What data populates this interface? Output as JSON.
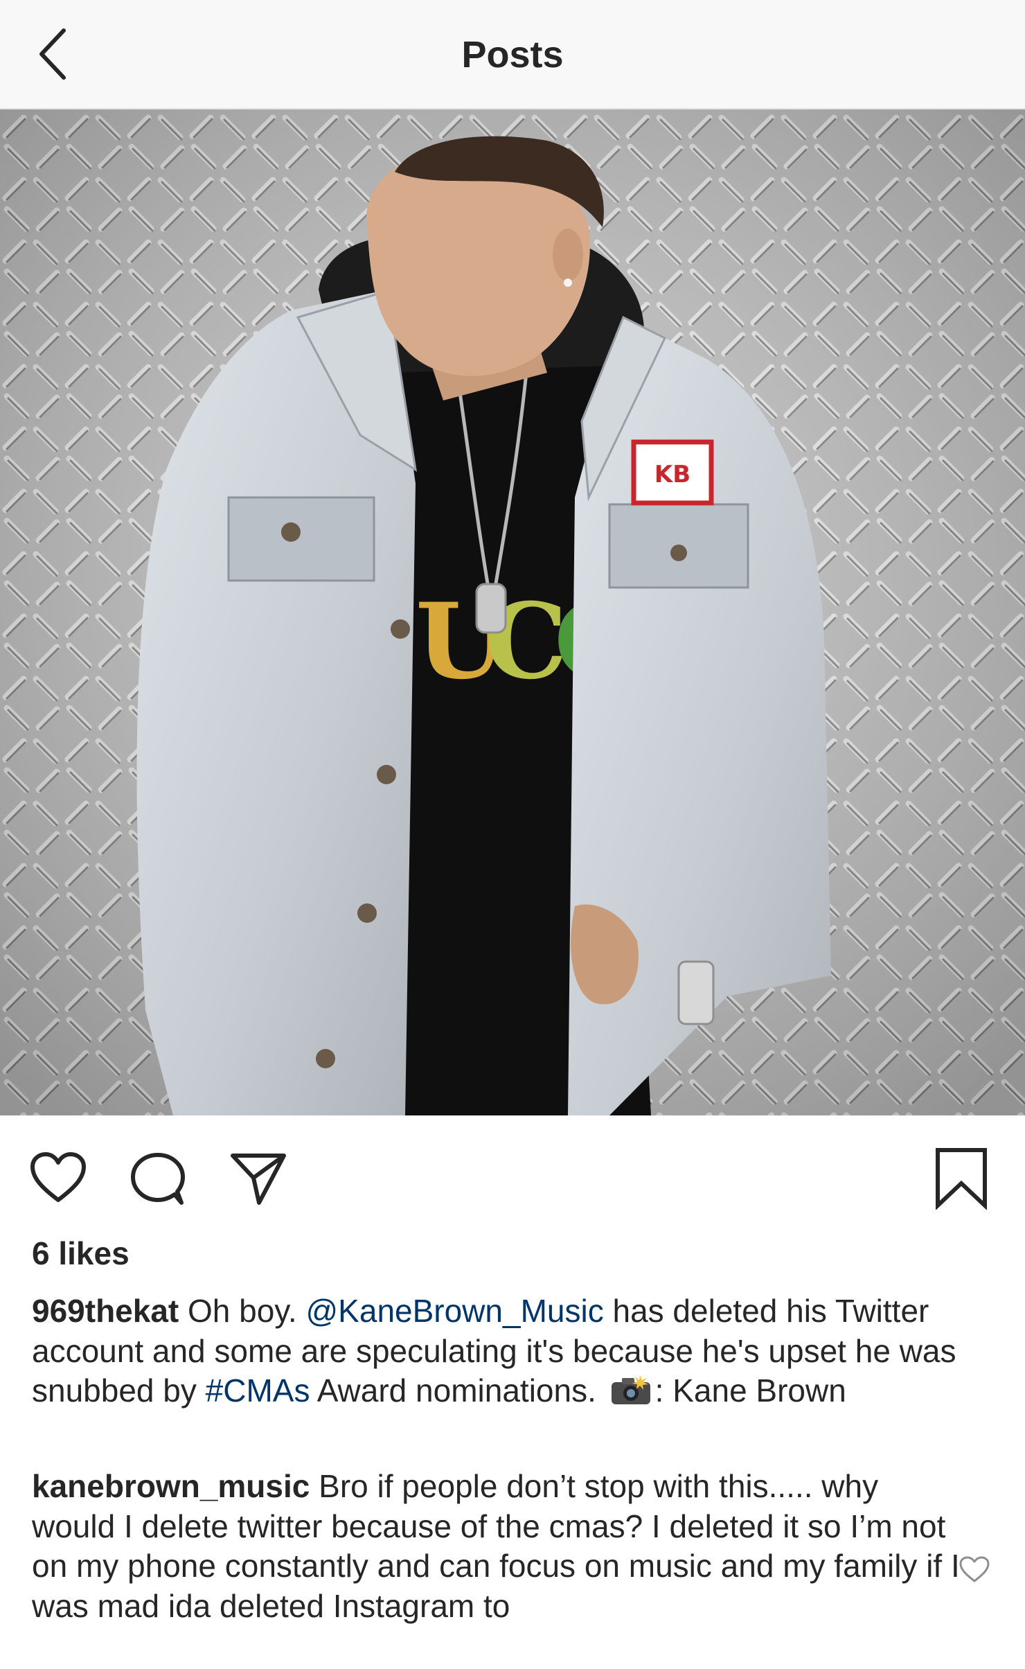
{
  "header": {
    "title": "Posts",
    "back_icon": "chevron-left-icon"
  },
  "post": {
    "image": {
      "patch_text": "KB",
      "shirt_text": "UCC"
    },
    "actions": {
      "like_icon": "heart-outline-icon",
      "comment_icon": "comment-bubble-icon",
      "share_icon": "paper-plane-icon",
      "save_icon": "bookmark-outline-icon"
    },
    "likes_text": "6 likes",
    "caption": {
      "username": "969thekat",
      "text_1": " Oh boy. ",
      "mention": "@KaneBrown_Music",
      "text_2": " has deleted his Twitter account and some are speculating it's because he's upset he was snubbed by ",
      "hashtag": "#CMAs",
      "text_3": " Award nominations. ",
      "camera_icon": "camera-flash-emoji-icon",
      "text_4": ": Kane Brown"
    },
    "comments": [
      {
        "username": "kanebrown_music",
        "text": " Bro if people don’t stop with this..... why would I delete twitter because of the cmas? I deleted it so I’m not on my phone constantly and can focus on music and my family if I was mad ida deleted Instagram to",
        "like_icon": "small-heart-outline-icon"
      }
    ]
  },
  "colors": {
    "link": "#003569",
    "text": "#262626",
    "header_bg": "#f8f8f8"
  }
}
